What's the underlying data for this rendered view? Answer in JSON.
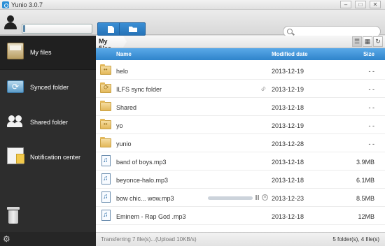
{
  "window": {
    "title": "Yunio 3.0.7"
  },
  "toolbar": {
    "search_placeholder": "",
    "account_usage_fraction": 0.03
  },
  "sidebar": {
    "items": [
      {
        "label": "My files",
        "icon": "drawer-icon"
      },
      {
        "label": "Synced folder",
        "icon": "sync-folder-icon"
      },
      {
        "label": "Shared folder",
        "icon": "users-icon"
      },
      {
        "label": "Notification center",
        "icon": "notice-board-icon"
      }
    ]
  },
  "breadcrumb": {
    "current": "My files"
  },
  "columns": {
    "name": "Name",
    "modified": "Modified date",
    "size": "Size"
  },
  "files": [
    {
      "name": "helo",
      "date": "2013-12-19",
      "size": "- -",
      "type": "shared-folder"
    },
    {
      "name": "ILFS sync folder",
      "date": "2013-12-19",
      "size": "- -",
      "type": "synced-folder"
    },
    {
      "name": "Shared",
      "date": "2013-12-18",
      "size": "- -",
      "type": "folder"
    },
    {
      "name": "yo",
      "date": "2013-12-19",
      "size": "- -",
      "type": "shared-folder"
    },
    {
      "name": "yunio",
      "date": "2013-12-28",
      "size": "- -",
      "type": "folder"
    },
    {
      "name": "band of boys.mp3",
      "date": "2013-12-18",
      "size": "3.9MB",
      "type": "audio"
    },
    {
      "name": "beyonce-halo.mp3",
      "date": "2013-12-18",
      "size": "6.1MB",
      "type": "audio"
    },
    {
      "name": "bow chic... wow.mp3",
      "date": "2013-12-23",
      "size": "8.5MB",
      "type": "audio-uploading",
      "progress": 0
    },
    {
      "name": "Eminem - Rap God .mp3",
      "date": "2013-12-18",
      "size": "12MB",
      "type": "audio"
    }
  ],
  "status": {
    "transfer": "Transferring 7 file(s)...(Upload 10KB/s)",
    "summary": "5 folder(s), 4 file(s)"
  },
  "colors": {
    "accent": "#2f84cb",
    "sidebar": "#2d2d2d"
  }
}
